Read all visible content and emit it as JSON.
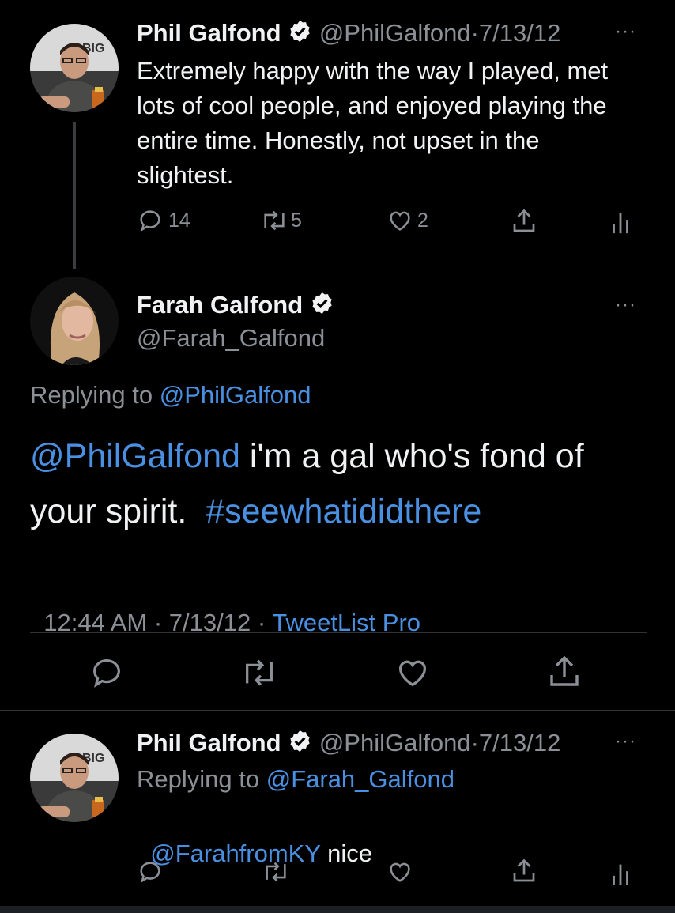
{
  "tweet1": {
    "name": "Phil Galfond",
    "handle": "@PhilGalfond",
    "date": "7/13/12",
    "sep": "·",
    "text": "Extremely happy with the way I played, met lots of cool people, and enjoyed playing the entire time. Honestly, not upset in the slightest.",
    "replies": "14",
    "retweets": "5",
    "likes": "2",
    "more": "···"
  },
  "main_tweet": {
    "name": "Farah Galfond",
    "handle": "@Farah_Galfond",
    "replying_prefix": "Replying to",
    "replying_to": "@PhilGalfond",
    "mention": "@PhilGalfond",
    "text_mid": " i'm a gal who's fond of your spirit.  ",
    "hashtag": "#seewhatididthere",
    "time": "12:44 AM",
    "date": "7/13/12",
    "client": "TweetList Pro",
    "sep": " · ",
    "more": "···"
  },
  "reply": {
    "name": "Phil Galfond",
    "handle": "@PhilGalfond",
    "date": "7/13/12",
    "sep": "·",
    "replying_prefix": "Replying to",
    "replying_to": "@Farah_Galfond",
    "mention": "@FarahfromKY",
    "text": " nice",
    "more": "···"
  },
  "avatar_text": "BIG",
  "colors": {
    "link": "#4a90e2",
    "muted": "#8b9096",
    "background": "#000000"
  },
  "icons": [
    "verified-icon",
    "reply-icon",
    "retweet-icon",
    "like-icon",
    "share-icon",
    "analytics-icon",
    "more-icon"
  ]
}
